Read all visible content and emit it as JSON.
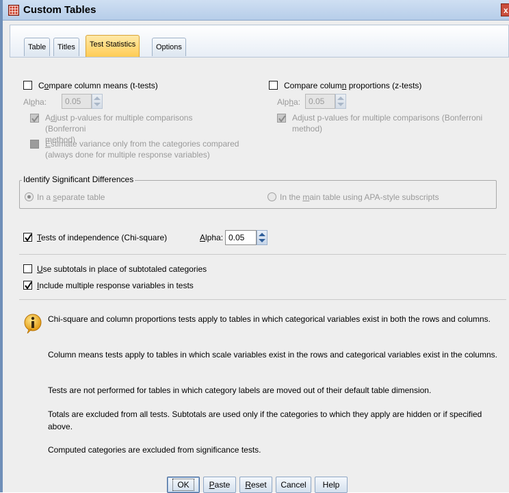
{
  "window": {
    "title": "Custom Tables",
    "close_glyph": "x"
  },
  "tabs": [
    {
      "label": "Table",
      "active": false
    },
    {
      "label": "Titles",
      "active": false
    },
    {
      "label": "Test Statistics",
      "active": true
    },
    {
      "label": "Options",
      "active": false
    }
  ],
  "column_means": {
    "checkbox_label_pre": "C",
    "checkbox_label_u": "o",
    "checkbox_label_post": "mpare column means (t-tests)",
    "checked": false,
    "alpha_label_pre": "Al",
    "alpha_label_u": "p",
    "alpha_label_post": "ha:",
    "alpha_value": "0.05",
    "adjust_label_pre": "A",
    "adjust_label_u": "d",
    "adjust_label_post": "just p-values for multiple comparisons (Bonferroni",
    "adjust_label_line2": "method)",
    "adjust_checked": true,
    "estimate_label_u": "E",
    "estimate_label_post": "stimate variance only from the categories compared",
    "estimate_label_line2": "(always done for multiple response variables)"
  },
  "column_proportions": {
    "checkbox_label_pre": "Compare colum",
    "checkbox_label_u": "n",
    "checkbox_label_post": " proportions (z-tests)",
    "checked": false,
    "alpha_label_pre": "Alp",
    "alpha_label_u": "h",
    "alpha_label_post": "a:",
    "alpha_value": "0.05",
    "adjust_label": "Adjust p-values for multiple comparisons (Bonferroni",
    "adjust_label_line2": "method)",
    "adjust_checked": true
  },
  "significant_differences": {
    "legend": "Identify Significant Differences",
    "option_separate_pre": "In a ",
    "option_separate_u": "s",
    "option_separate_post": "eparate table",
    "option_main_pre": "In the ",
    "option_main_u": "m",
    "option_main_post": "ain table using APA-style subscripts",
    "selected": "separate"
  },
  "chi_square": {
    "label_u": "T",
    "label_post": "ests of independence (Chi-square)",
    "checked": true,
    "alpha_label_u": "A",
    "alpha_label_post": "lpha:",
    "alpha_value": "0.05"
  },
  "subtotals": {
    "label_u": "U",
    "label_post": "se subtotals in place of subtotaled categories",
    "checked": false
  },
  "multiple_response": {
    "label_u": "I",
    "label_post": "nclude multiple response variables in tests",
    "checked": true
  },
  "info": {
    "icon": "info-icon",
    "notes": [
      "Chi-square and column proportions tests apply to tables in which categorical variables exist in both the rows and columns.",
      "Column means tests apply to tables in which scale variables exist in the rows and categorical variables exist in the columns.",
      "Tests are not performed for tables in which category labels are moved out of their default table dimension.",
      "Totals are excluded from all tests. Subtotals are used only if the categories to which they apply are hidden or if specified above.",
      "Computed categories are excluded from significance tests."
    ]
  },
  "buttons": {
    "ok": "OK",
    "paste_u": "P",
    "paste_post": "aste",
    "reset_u": "R",
    "reset_post": "eset",
    "cancel": "Cancel",
    "help": "Help"
  },
  "colors": {
    "active_tab": "#ffcc55",
    "title_bar": "#b6cde9",
    "disabled_text": "#9a9a9a"
  }
}
